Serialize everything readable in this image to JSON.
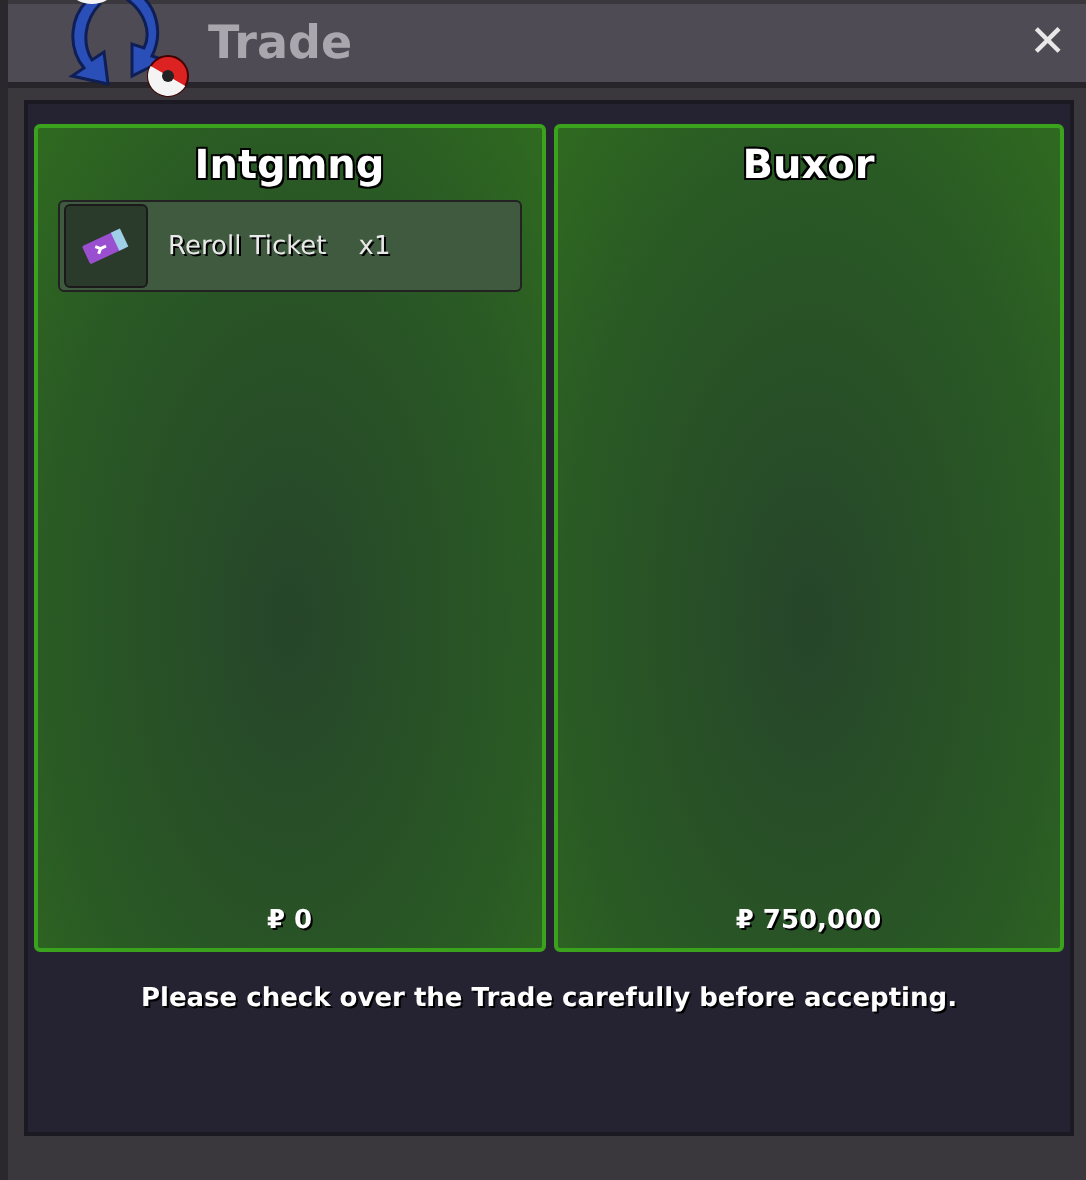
{
  "window": {
    "title": "Trade",
    "close": "✕"
  },
  "offers": [
    {
      "player": "Intgmng",
      "items": [
        {
          "name": "Reroll Ticket",
          "quantity": "x1"
        }
      ],
      "money": "₽ 0"
    },
    {
      "player": "Buxor",
      "money": "₽ 750,000"
    }
  ],
  "message": "Please check over the Trade carefully before accepting."
}
